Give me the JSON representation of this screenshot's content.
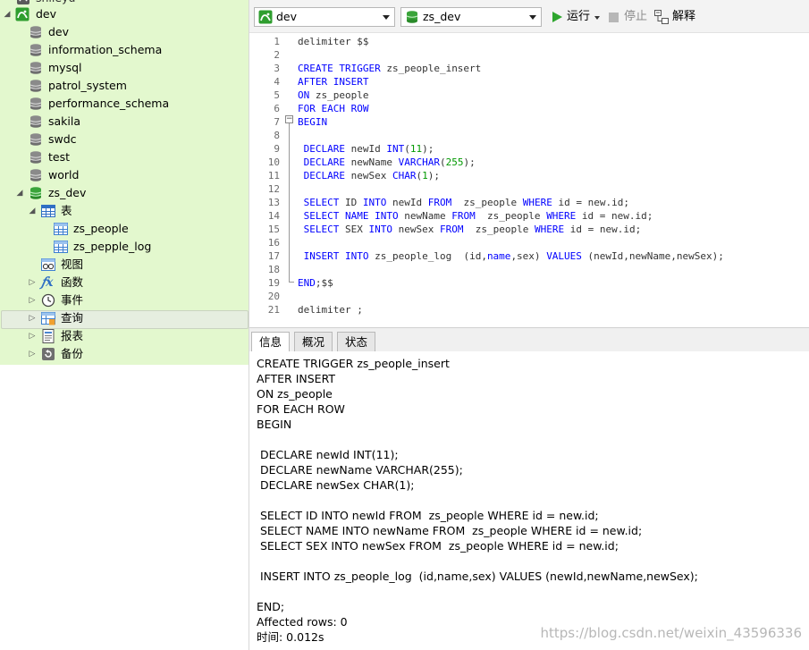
{
  "tree": {
    "top_partial_label": "shileyu",
    "connection": "dev",
    "databases": [
      "dev",
      "information_schema",
      "mysql",
      "patrol_system",
      "performance_schema",
      "sakila",
      "swdc",
      "test",
      "world"
    ],
    "open_db": "zs_dev",
    "tables_label": "表",
    "tables": [
      "zs_people",
      "zs_pepple_log"
    ],
    "views_label": "视图",
    "functions_label": "函数",
    "events_label": "事件",
    "queries_label": "查询",
    "reports_label": "报表",
    "backups_label": "备份"
  },
  "toolbar": {
    "connection_value": "dev",
    "database_value": "zs_dev",
    "run_label": "运行",
    "stop_label": "停止",
    "explain_label": "解释"
  },
  "editor": {
    "line_numbers": [
      "1",
      "2",
      "3",
      "4",
      "5",
      "6",
      "7",
      "8",
      "9",
      "10",
      "11",
      "12",
      "13",
      "14",
      "15",
      "16",
      "17",
      "18",
      "19",
      "20",
      "21"
    ]
  },
  "result_tabs": [
    "信息",
    "概况",
    "状态"
  ],
  "message_lines": [
    "CREATE TRIGGER zs_people_insert",
    "AFTER INSERT",
    "ON zs_people",
    "FOR EACH ROW",
    "BEGIN",
    "",
    " DECLARE newId INT(11);",
    " DECLARE newName VARCHAR(255);",
    " DECLARE newSex CHAR(1);",
    "",
    " SELECT ID INTO newId FROM  zs_people WHERE id = new.id;",
    " SELECT NAME INTO newName FROM  zs_people WHERE id = new.id;",
    " SELECT SEX INTO newSex FROM  zs_people WHERE id = new.id;",
    "",
    " INSERT INTO zs_people_log  (id,name,sex) VALUES (newId,newName,newSex);",
    "",
    "END;",
    "Affected rows: 0",
    "时间: 0.012s"
  ],
  "watermark": "https://blog.csdn.net/weixin_43596336"
}
